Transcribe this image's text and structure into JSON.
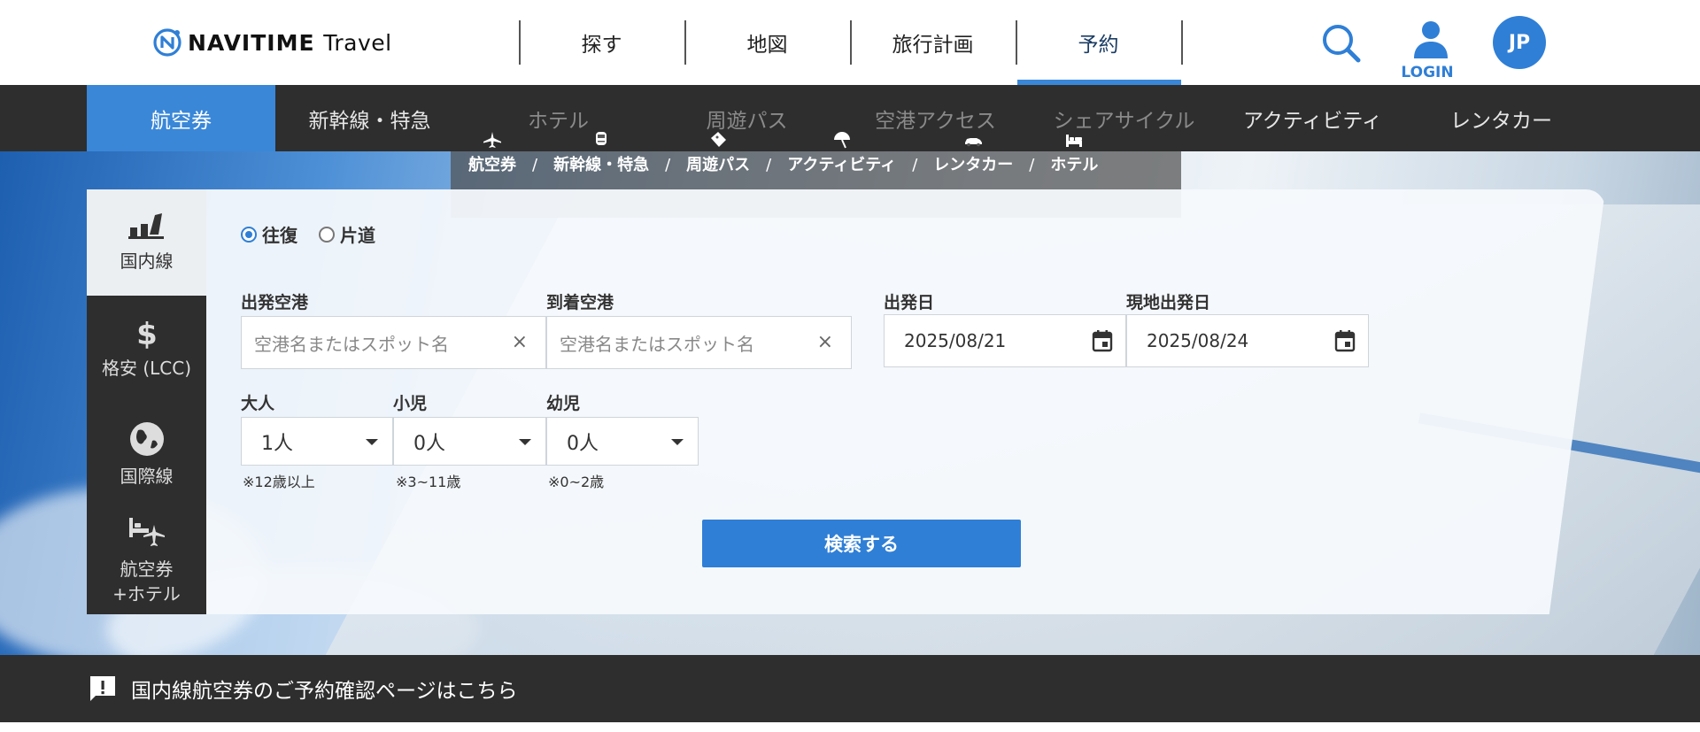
{
  "header": {
    "logo_brand": "NAVITIME",
    "logo_suffix": "Travel",
    "nav": [
      {
        "label": "探す"
      },
      {
        "label": "地図"
      },
      {
        "label": "旅行計画"
      },
      {
        "label": "予約"
      }
    ],
    "active_nav": "予約",
    "login_label": "LOGIN",
    "lang_label": "JP"
  },
  "sub_nav": {
    "items": [
      "航空券",
      "新幹線・特急",
      "ホテル",
      "周遊パス",
      "空港アクセス",
      "シェアサイクル",
      "アクティビティ",
      "レンタカー"
    ],
    "active": "航空券"
  },
  "overlay_menu": {
    "items": [
      "航空券",
      "新幹線・特急",
      "周遊パス",
      "アクティビティ",
      "レンタカー",
      "ホテル"
    ],
    "separator": "/"
  },
  "panel_tabs": [
    {
      "label": "国内線",
      "icon": "domestic-flight-icon"
    },
    {
      "label": "格安 (LCC)",
      "icon": "dollar-icon"
    },
    {
      "label": "国際線",
      "icon": "globe-icon"
    },
    {
      "label_line1": "航空券",
      "label_line2": "+ホテル",
      "icon": "flight-hotel-icon"
    }
  ],
  "trip_type": {
    "options": [
      "往復",
      "片道"
    ],
    "selected": "往復"
  },
  "form": {
    "departure_label": "出発空港",
    "departure_placeholder": "空港名またはスポット名",
    "arrival_label": "到着空港",
    "arrival_placeholder": "空港名またはスポット名",
    "clear_symbol": "×",
    "depart_date_label": "出発日",
    "depart_date_value": "2025/08/21",
    "return_date_label": "現地出発日",
    "return_date_value": "2025/08/24",
    "adult_label": "大人",
    "adult_value": "1人",
    "adult_note": "※12歳以上",
    "child_label": "小児",
    "child_value": "0人",
    "child_note": "※3~11歳",
    "infant_label": "幼児",
    "infant_value": "0人",
    "infant_note": "※0~2歳",
    "submit_label": "検索する"
  },
  "notice": {
    "text": "国内線航空券のご予約確認ページはこちら"
  },
  "colors": {
    "accent": "#2f7fd6",
    "dark_bar": "#2e2e2e"
  }
}
